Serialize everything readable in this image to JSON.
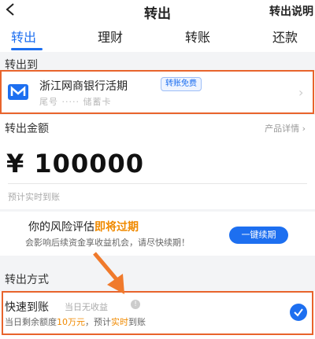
{
  "header": {
    "title": "转出",
    "help_label": "转出说明"
  },
  "tabs": [
    {
      "label": "转出",
      "active": true
    },
    {
      "label": "理财",
      "active": false
    },
    {
      "label": "转账",
      "active": false
    },
    {
      "label": "还款",
      "active": false
    }
  ],
  "destination": {
    "section_label": "转出到",
    "bank_name": "浙江网商银行活期",
    "badge": "转账免费",
    "tail_text": "尾号 ·····  储蓄卡"
  },
  "amount": {
    "section_label": "转出金额",
    "product_link": "产品详情",
    "currency": "¥",
    "value": "100000",
    "arrival_note": "预计实时到账"
  },
  "risk": {
    "title_prefix": "你的风险评估",
    "title_highlight": "即将过期",
    "subtitle": "会影响后续资金享收益机会，请尽快续期！",
    "button_label": "一键续期"
  },
  "method": {
    "section_label": "转出方式",
    "option_title": "快速到账",
    "option_note": "当日无收益",
    "desc_prefix": "当日剩余额度",
    "desc_amount": "10万元",
    "desc_mid": "，预计",
    "desc_highlight": "实时",
    "desc_suffix": "到账",
    "selected": true
  },
  "colors": {
    "accent": "#1d6ff0",
    "highlight_orange": "#f08a00",
    "annotation": "#e8642c"
  }
}
